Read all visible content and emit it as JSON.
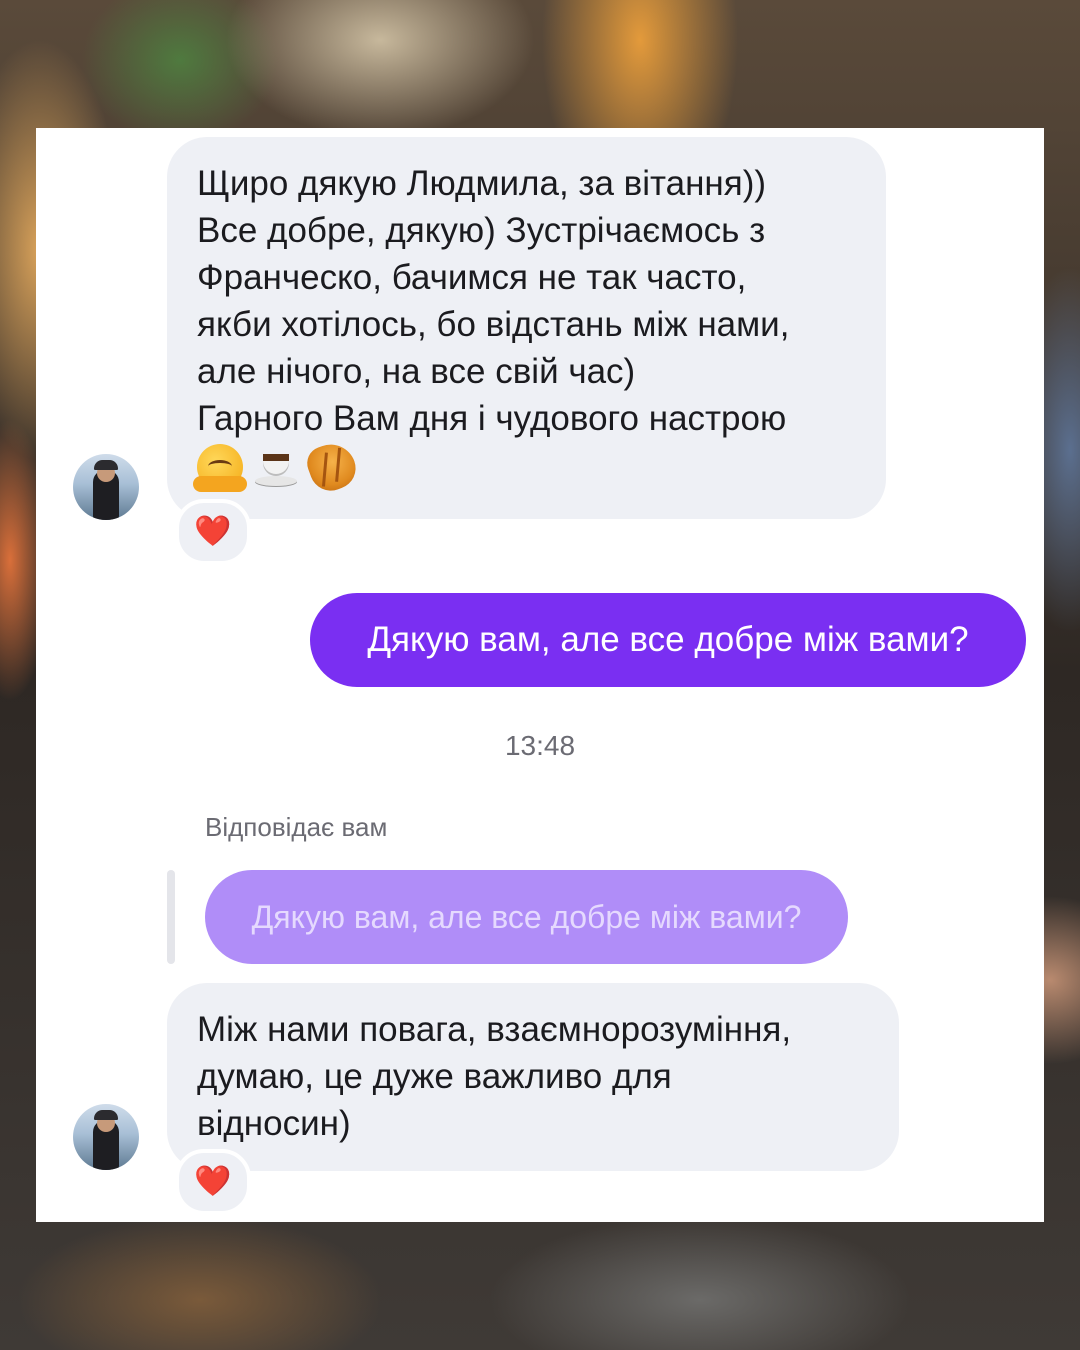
{
  "messages": [
    {
      "direction": "incoming",
      "lines": [
        "Щиро дякую Людмила, за вітання))",
        "Все добре, дякую) Зустрічаємось з",
        "Франческо, бачимся не так часто,",
        "якби хотілось, бо відстань між нами,",
        "але нічого, на все свій час)",
        "Гарного Вам дня і чудового настрою"
      ],
      "emojis": [
        "hugging-face-emoji",
        "coffee-emoji",
        "croissant-emoji"
      ],
      "reaction": "❤️"
    },
    {
      "direction": "outgoing",
      "text": "Дякую вам, але все добре між вами?"
    },
    {
      "direction": "incoming",
      "reply_label": "Відповідає вам",
      "quoted_text": "Дякую вам, але все добре між вами?",
      "lines": [
        "Між нами повага, взаємнорозуміння,",
        "думаю, це дуже важливо для",
        "відносин)"
      ],
      "reaction": "❤️"
    }
  ],
  "timestamp": "13:48",
  "colors": {
    "outgoing_bubble": "#7a2ff2",
    "quoted_bubble": "#b08df8",
    "incoming_bubble": "#eef0f5",
    "reaction_heart": "#e0172b"
  }
}
